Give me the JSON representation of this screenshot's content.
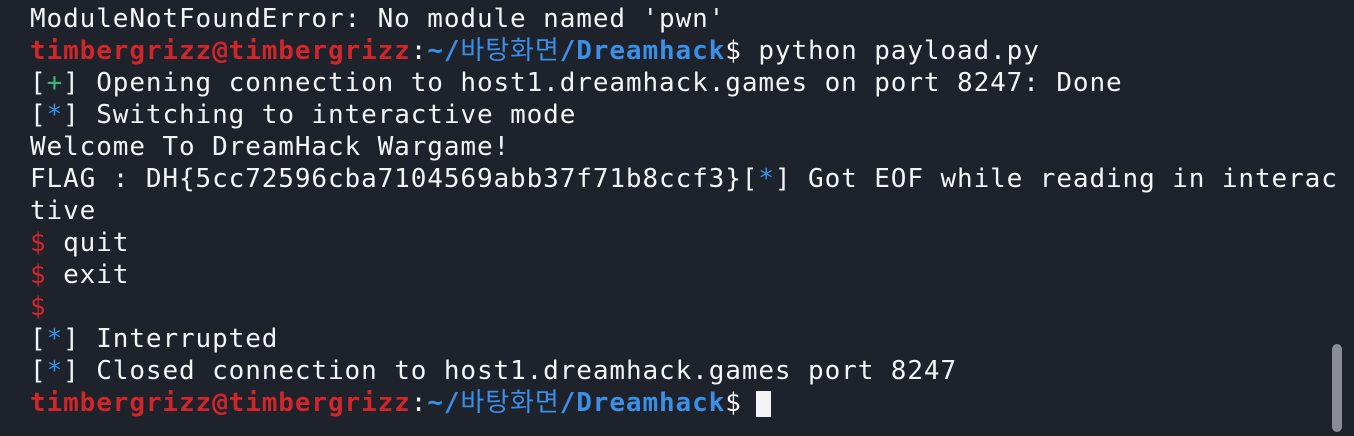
{
  "terminal": {
    "lines": [
      {
        "text": "ModuleNotFoundError: No module named 'pwn'"
      },
      {
        "prompt": {
          "user": "timbergrizz@timbergrizz",
          "sep": ":",
          "path_home": "~/",
          "path_korean": "바탕화면",
          "path_rest": "/Dreamhack",
          "dollar": "$"
        },
        "command": " python payload.py"
      },
      {
        "bracket_open": "[",
        "marker": "+",
        "bracket_close": "]",
        "text": " Opening connection to host1.dreamhack.games on port 8247: Done"
      },
      {
        "bracket_open": "[",
        "marker": "*",
        "bracket_close": "]",
        "text": " Switching to interactive mode"
      },
      {
        "text": "Welcome To DreamHack Wargame!"
      },
      {
        "text_before": "FLAG : DH{5cc72596cba7104569abb37f71b8ccf3}",
        "bracket_open": "[",
        "marker": "*",
        "bracket_close": "]",
        "text_after": " Got EOF while reading in interac"
      },
      {
        "text": "tive"
      },
      {
        "dollar": "$",
        "text": " quit"
      },
      {
        "dollar": "$",
        "text": " exit"
      },
      {
        "dollar": "$",
        "text": ""
      },
      {
        "bracket_open": "[",
        "marker": "*",
        "bracket_close": "]",
        "text": " Interrupted"
      },
      {
        "bracket_open": "[",
        "marker": "*",
        "bracket_close": "]",
        "text": " Closed connection to host1.dreamhack.games port 8247"
      },
      {
        "prompt": {
          "user": "timbergrizz@timbergrizz",
          "sep": ":",
          "path_home": "~/",
          "path_korean": "바탕화면",
          "path_rest": "/Dreamhack",
          "dollar": "$"
        },
        "command": ""
      }
    ],
    "colors": {
      "background": "#1d222b",
      "text": "#f2f4f6",
      "user": "#d0262b",
      "path": "#3c8fe6",
      "plus_marker": "#3fb47c",
      "star_marker": "#3c8fe6"
    },
    "icons": {
      "cursor": "block-cursor-icon"
    }
  }
}
